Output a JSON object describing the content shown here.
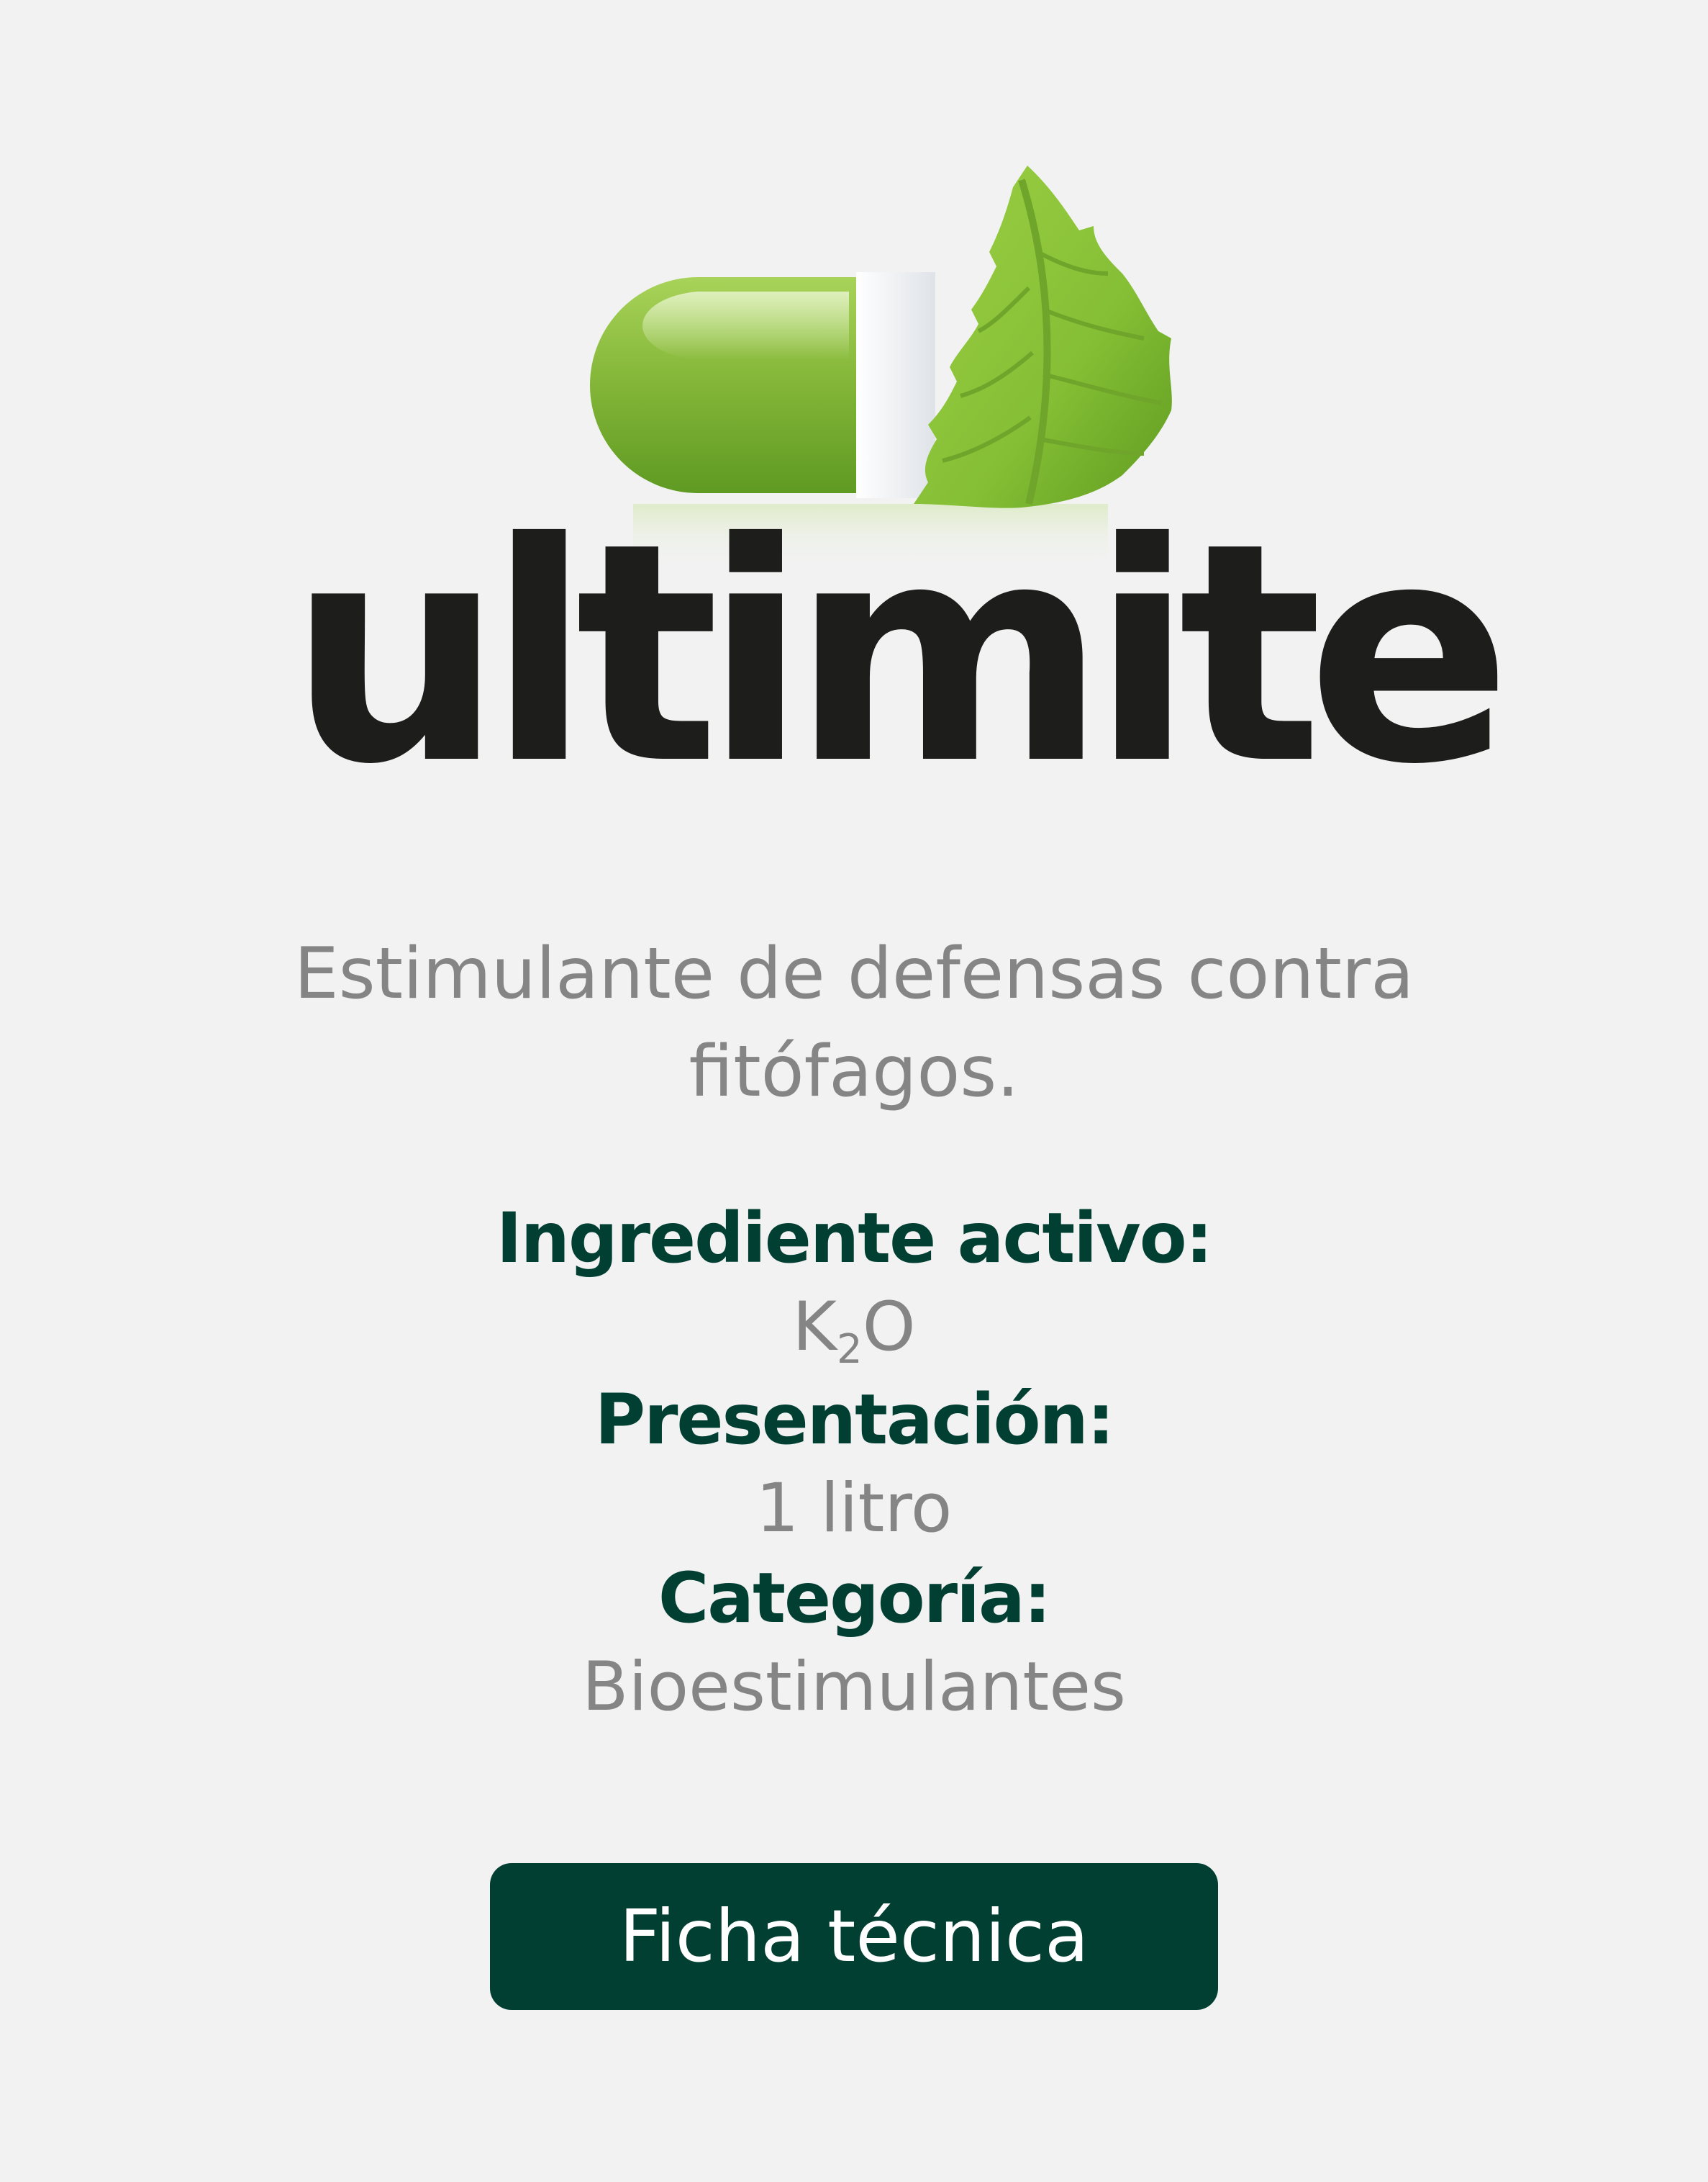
{
  "logo": {
    "wordmark": "ultimite",
    "icon": "pill-leaf-icon"
  },
  "product": {
    "description": "Estimulante de defensas contra fitófagos."
  },
  "specs": {
    "ingredient": {
      "label": "Ingrediente activo:",
      "value_base": "K",
      "value_sub": "2",
      "value_tail": "O"
    },
    "presentation": {
      "label": "Presentación:",
      "value": "1 litro"
    },
    "category": {
      "label": "Categoría:",
      "value": "Bioestimulantes"
    }
  },
  "actions": {
    "datasheet_label": "Ficha técnica"
  },
  "colors": {
    "background": "#f2f2f2",
    "brand_dark_green": "#023f33",
    "text_gray": "#858585",
    "wordmark": "#1d1d1b",
    "pill_green": "#7fb133",
    "leaf_green": "#8cc63f"
  }
}
